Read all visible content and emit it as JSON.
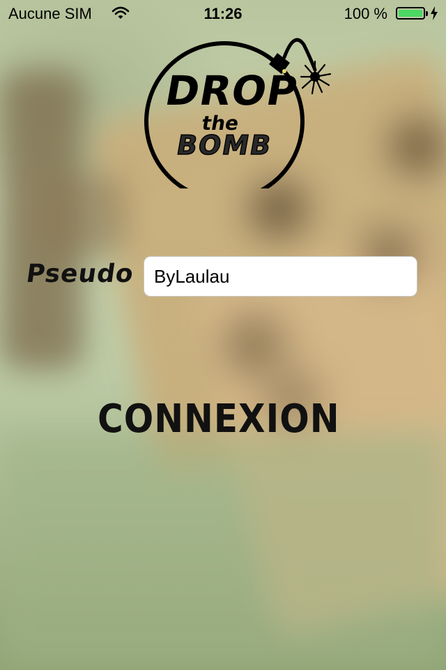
{
  "status_bar": {
    "carrier": "Aucune SIM",
    "time": "11:26",
    "battery_percent": "100 %",
    "battery_level": 1.0,
    "icons": [
      "wifi-icon",
      "battery-icon",
      "charging-bolt-icon"
    ]
  },
  "logo": {
    "line1": "DROP",
    "line2": "the",
    "line3": "BOMB",
    "icon": "bomb-icon"
  },
  "login": {
    "pseudo_label": "Pseudo :",
    "pseudo_value": "ByLaulau",
    "connect_label": "CONNEXION"
  },
  "colors": {
    "battery_fill": "#4cd964",
    "text": "#111111",
    "input_background": "#ffffff"
  }
}
